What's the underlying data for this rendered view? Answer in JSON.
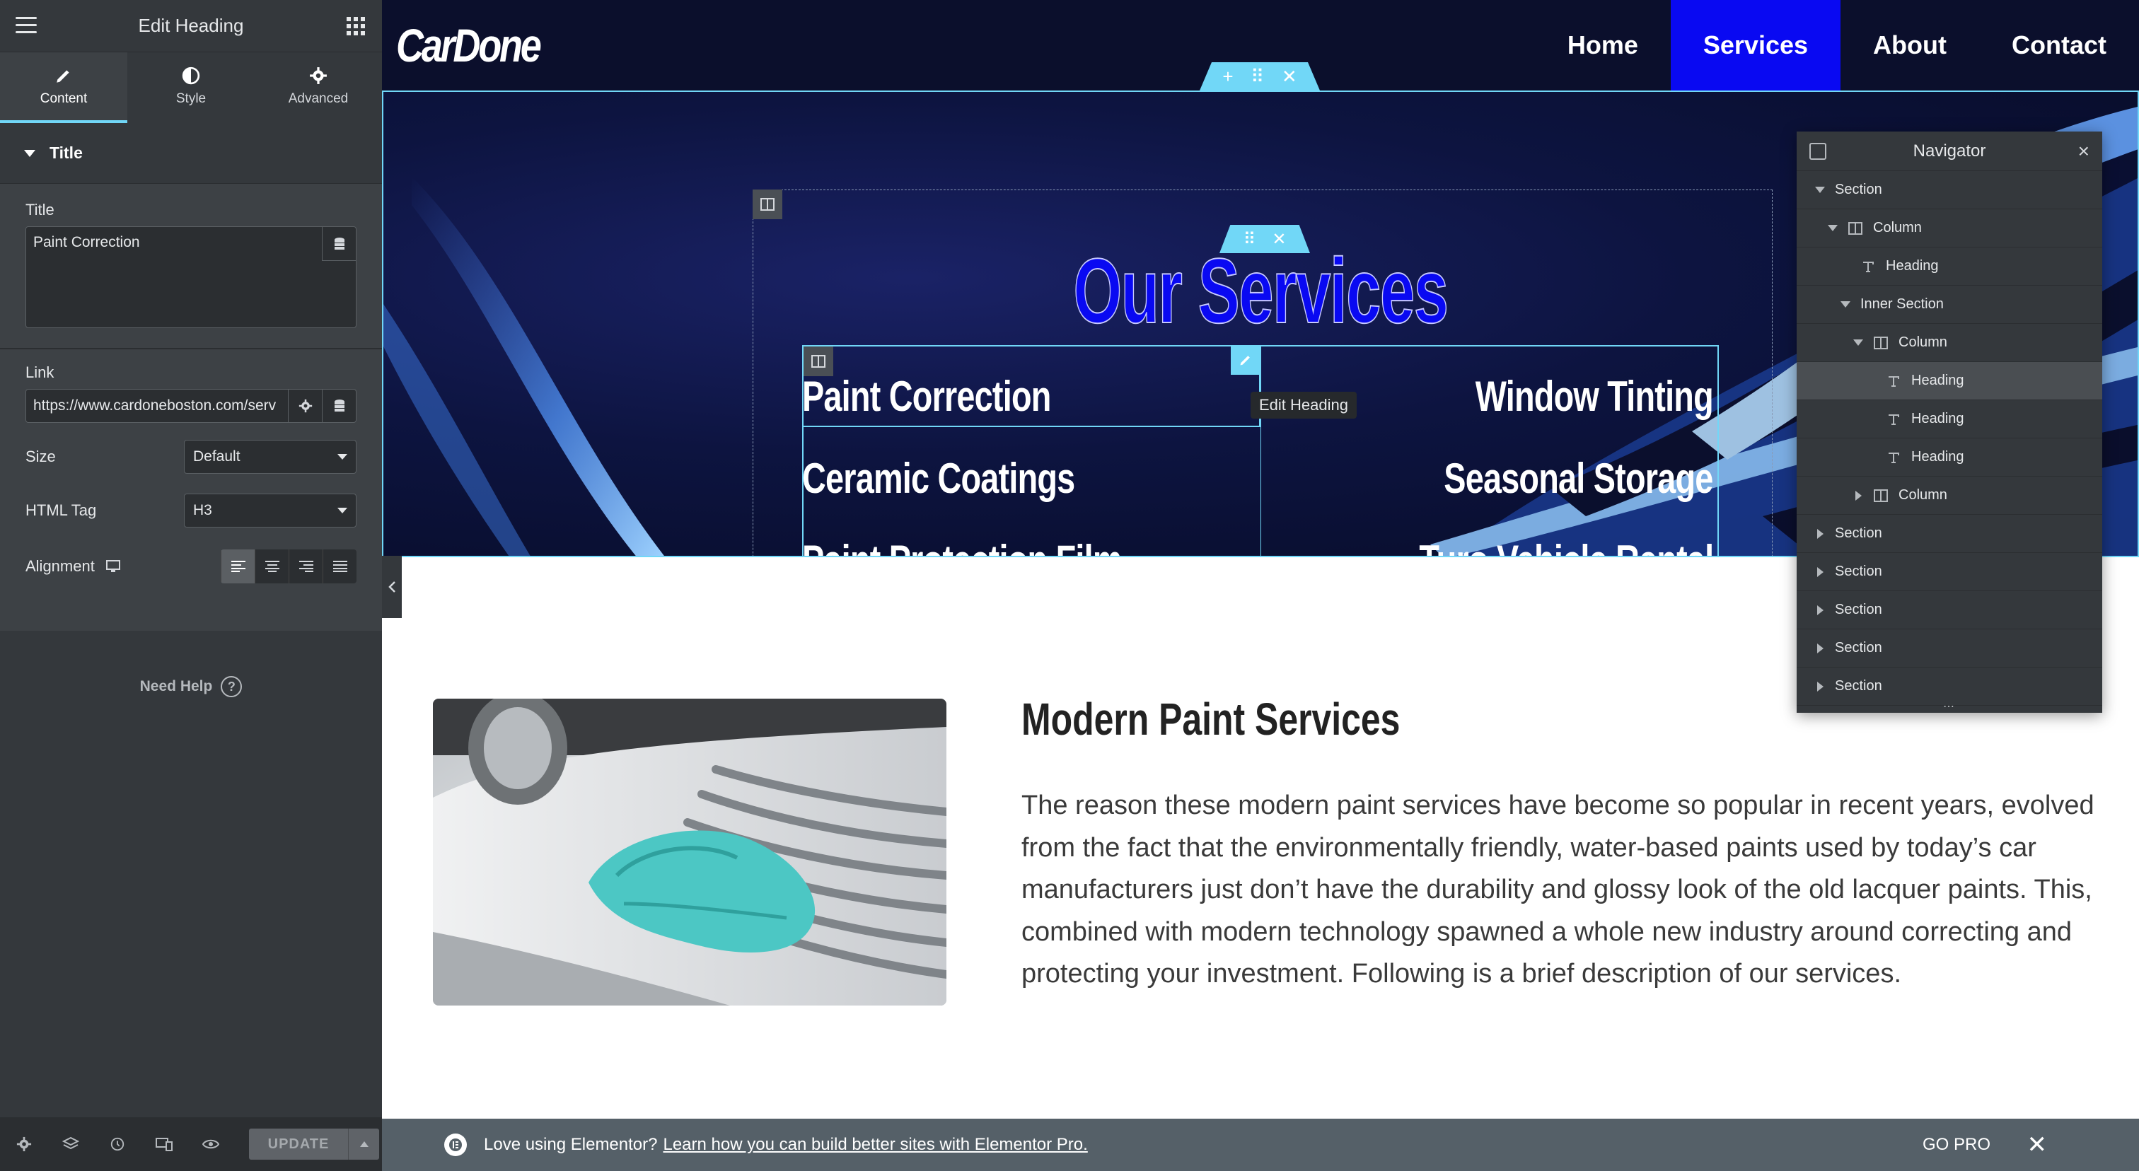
{
  "panel": {
    "header_title": "Edit Heading",
    "tabs": [
      {
        "label": "Content",
        "icon": "pencil-icon",
        "active": true
      },
      {
        "label": "Style",
        "icon": "half-circle-icon",
        "active": false
      },
      {
        "label": "Advanced",
        "icon": "gear-icon",
        "active": false
      }
    ],
    "section_title": "Title",
    "title_label": "Title",
    "title_value": "Paint Correction",
    "link_label": "Link",
    "link_value": "https://www.cardoneboston.com/serv",
    "size_label": "Size",
    "size_value": "Default",
    "html_tag_label": "HTML Tag",
    "html_tag_value": "H3",
    "alignment_label": "Alignment",
    "need_help": "Need Help",
    "update_label": "UPDATE"
  },
  "site": {
    "logo": "CarDone",
    "nav": [
      {
        "label": "Home",
        "active": false
      },
      {
        "label": "Services",
        "active": true
      },
      {
        "label": "About",
        "active": false
      },
      {
        "label": "Contact",
        "active": false
      }
    ],
    "hero_title": "Our Services",
    "services_left": [
      "Paint Correction",
      "Ceramic Coatings",
      "Paint Protection Film"
    ],
    "services_right": [
      "Window Tinting",
      "Seasonal Storage",
      "Turo Vehicle Rental"
    ],
    "tooltip": "Edit Heading",
    "content_title": "Modern Paint Services",
    "content_body": "The reason these modern paint services have become so popular in recent years, evolved from the fact that the environmentally friendly, water-based paints used by today’s car manufacturers just don’t have the durability and glossy look of the old lacquer paints. This, combined with modern technology spawned a whole new industry around correcting and protecting your investment. Following is a brief description of our services."
  },
  "navigator": {
    "title": "Navigator",
    "items": [
      {
        "label": "Section",
        "depth": 0,
        "toggle": "down",
        "icon": "none"
      },
      {
        "label": "Column",
        "depth": 1,
        "toggle": "down",
        "icon": "column-icon"
      },
      {
        "label": "Heading",
        "depth": 2,
        "toggle": "none",
        "icon": "heading-icon"
      },
      {
        "label": "Inner Section",
        "depth": 2,
        "toggle": "down",
        "icon": "none"
      },
      {
        "label": "Column",
        "depth": 3,
        "toggle": "down",
        "icon": "column-icon"
      },
      {
        "label": "Heading",
        "depth": 4,
        "toggle": "none",
        "icon": "heading-icon",
        "selected": true
      },
      {
        "label": "Heading",
        "depth": 4,
        "toggle": "none",
        "icon": "heading-icon"
      },
      {
        "label": "Heading",
        "depth": 4,
        "toggle": "none",
        "icon": "heading-icon"
      },
      {
        "label": "Column",
        "depth": 3,
        "toggle": "right",
        "icon": "column-icon"
      },
      {
        "label": "Section",
        "depth": 0,
        "toggle": "right",
        "icon": "none"
      },
      {
        "label": "Section",
        "depth": 0,
        "toggle": "right",
        "icon": "none"
      },
      {
        "label": "Section",
        "depth": 0,
        "toggle": "right",
        "icon": "none"
      },
      {
        "label": "Section",
        "depth": 0,
        "toggle": "right",
        "icon": "none"
      },
      {
        "label": "Section",
        "depth": 0,
        "toggle": "right",
        "icon": "none"
      }
    ]
  },
  "promo": {
    "text": "Love using Elementor?",
    "link": "Learn how you can build better sites with Elementor Pro.",
    "go_pro": "GO PRO"
  },
  "colors": {
    "accent": "#71d7f7",
    "nav_active": "#0909f2",
    "panel_bg": "#34383c",
    "header_bg": "#0b0f2c"
  }
}
